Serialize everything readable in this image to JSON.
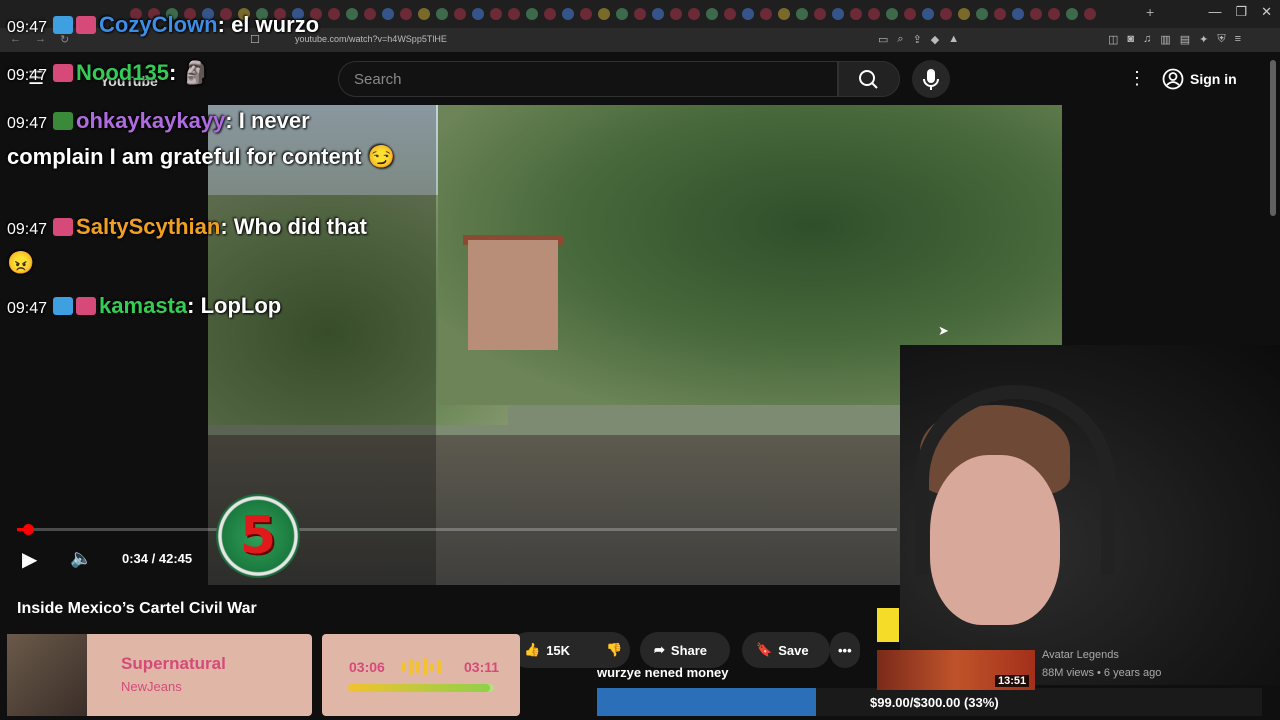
{
  "browser": {
    "url": "youtube.com/watch?v=h4WSpp5TlHE",
    "colors": {
      "tab_dot": "#6b2a36",
      "chrome_bg": "#1f1f1f"
    }
  },
  "header": {
    "logo_text": "YouTube",
    "search_placeholder": "Search",
    "sign_in_label": "Sign in"
  },
  "player": {
    "current_time": "0:34",
    "total_time": "42:45",
    "time_display": "0:34 / 42:45",
    "progress_fraction": 0.013,
    "badge_text": "5"
  },
  "video": {
    "title": "Inside Mexico’s Cartel Civil War"
  },
  "actions": {
    "like_count": "15K",
    "share_label": "Share",
    "save_label": "Save"
  },
  "chat": [
    {
      "time": "09:47",
      "user": "CozyClown",
      "message": "el wurzo",
      "color": "#3a8ee6"
    },
    {
      "time": "09:47",
      "user": "Nood135",
      "message": "",
      "color": "#33cc55"
    },
    {
      "time": "09:47",
      "user": "ohkaykaykayy",
      "message": "I never complain I am grateful for content",
      "color": "#b06be0"
    },
    {
      "time": "09:47",
      "user": "SaltyScythian",
      "message": "Who did that",
      "color": "#f0a020"
    },
    {
      "time": "09:47",
      "user": "kamasta",
      "message": "LopLop",
      "color": "#33cc55"
    }
  ],
  "music": {
    "title": "Supernatural",
    "artist": "NewJeans",
    "elapsed": "03:06",
    "duration": "03:11",
    "progress_fraction": 0.97
  },
  "donation": {
    "label": "wurzye nened money",
    "progress_text": "$99.00/$300.00 (33%)",
    "progress_fraction": 0.33
  },
  "recommendation": {
    "duration": "13:51",
    "channel": "Avatar Legends",
    "meta": "88M views • 6 years ago"
  }
}
